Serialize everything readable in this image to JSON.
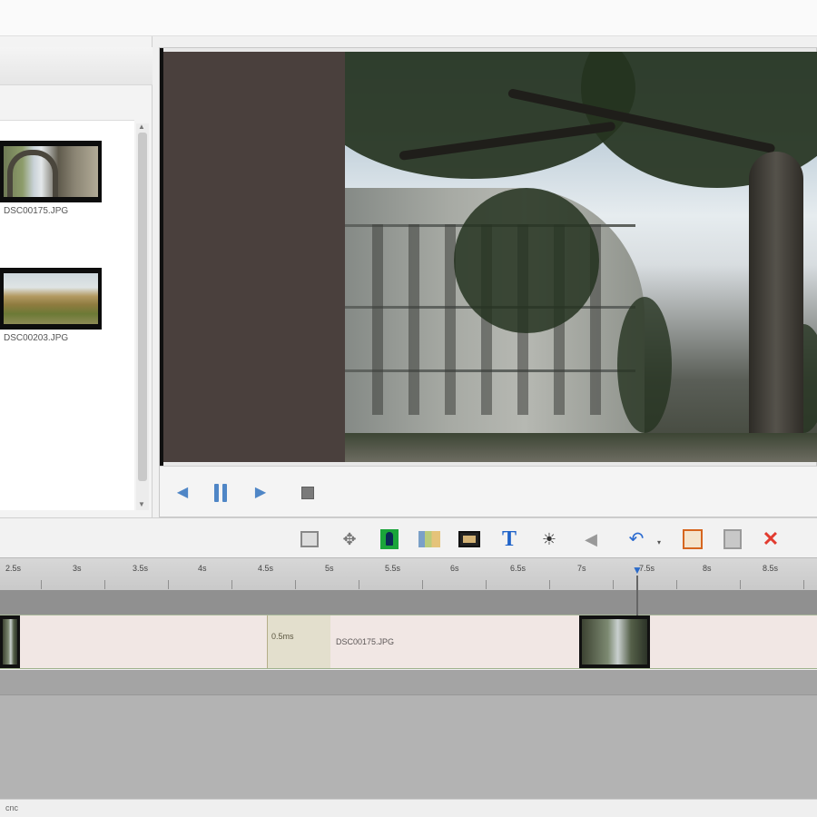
{
  "media_bin": {
    "items": [
      {
        "name": "DSC00175.JPG",
        "thumb": "arch-icon"
      },
      {
        "name": "DSC00203.JPG",
        "thumb": "ruin-icon"
      }
    ]
  },
  "preview": {
    "buttons": [
      {
        "icon": "step-back-icon",
        "glyph": "◀"
      },
      {
        "icon": "pause-icon",
        "glyph": ""
      },
      {
        "icon": "step-forward-icon",
        "glyph": "▶"
      },
      {
        "icon": "stop-icon",
        "glyph": ""
      }
    ]
  },
  "toolbar": {
    "tools": [
      "split-clip-icon",
      "transition-icon",
      "green-screen-icon",
      "chart-icon",
      "film-strip-icon",
      "text-icon",
      "brightness-icon",
      "audio-icon",
      "undo-icon",
      "bookmark-icon",
      "document-icon",
      "delete-icon"
    ],
    "text_tool_label": "T",
    "undo_glyph": "↶",
    "dropdown_glyph": "▾",
    "delete_glyph": "✕",
    "brightness_glyph": "☀",
    "audio_glyph": "◀",
    "move_glyph": "✥"
  },
  "timeline": {
    "ticks": [
      "2.5s",
      "3s",
      "3.5s",
      "4s",
      "4.5s",
      "5s",
      "5.5s",
      "6s",
      "6.5s",
      "7s",
      "7.5s",
      "8s",
      "8.5s"
    ],
    "playhead_glyph": "▼",
    "transition_label": "0.5ms",
    "clip_label": "DSC00175.JPG"
  },
  "status": {
    "text": "cnc"
  },
  "colors": {
    "accent": "#4f86c6",
    "delete": "#e23b2f",
    "text_tool": "#1f63c9"
  }
}
